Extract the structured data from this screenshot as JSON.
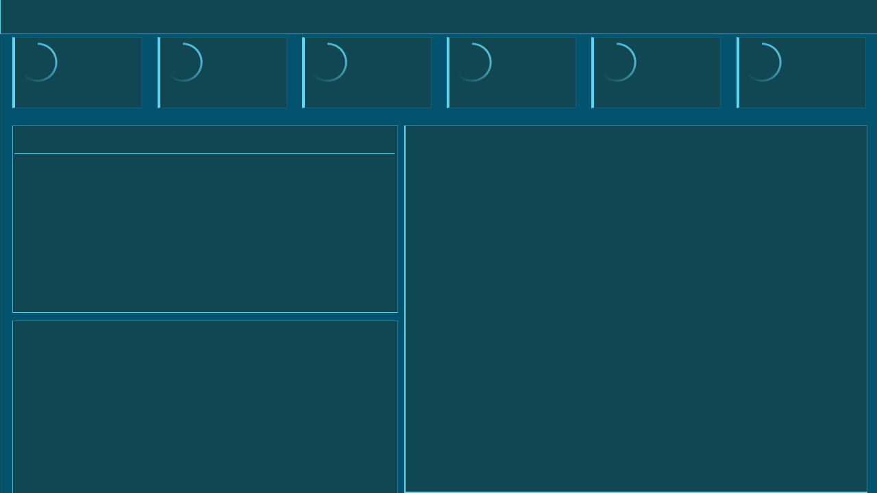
{
  "header": {
    "title": ""
  },
  "kpis": [
    {
      "label": "",
      "value": ""
    },
    {
      "label": "",
      "value": ""
    },
    {
      "label": "",
      "value": ""
    },
    {
      "label": "",
      "value": ""
    },
    {
      "label": "",
      "value": ""
    },
    {
      "label": "",
      "value": ""
    }
  ],
  "panels": {
    "top_left": {
      "title": ""
    },
    "bottom_left": {
      "title": ""
    },
    "right": {
      "title": ""
    }
  },
  "colors": {
    "background": "#03536f",
    "panel": "#104753",
    "accent": "#62d4f1"
  },
  "icons": {
    "kpi_indicator": "loading-spinner-icon"
  }
}
